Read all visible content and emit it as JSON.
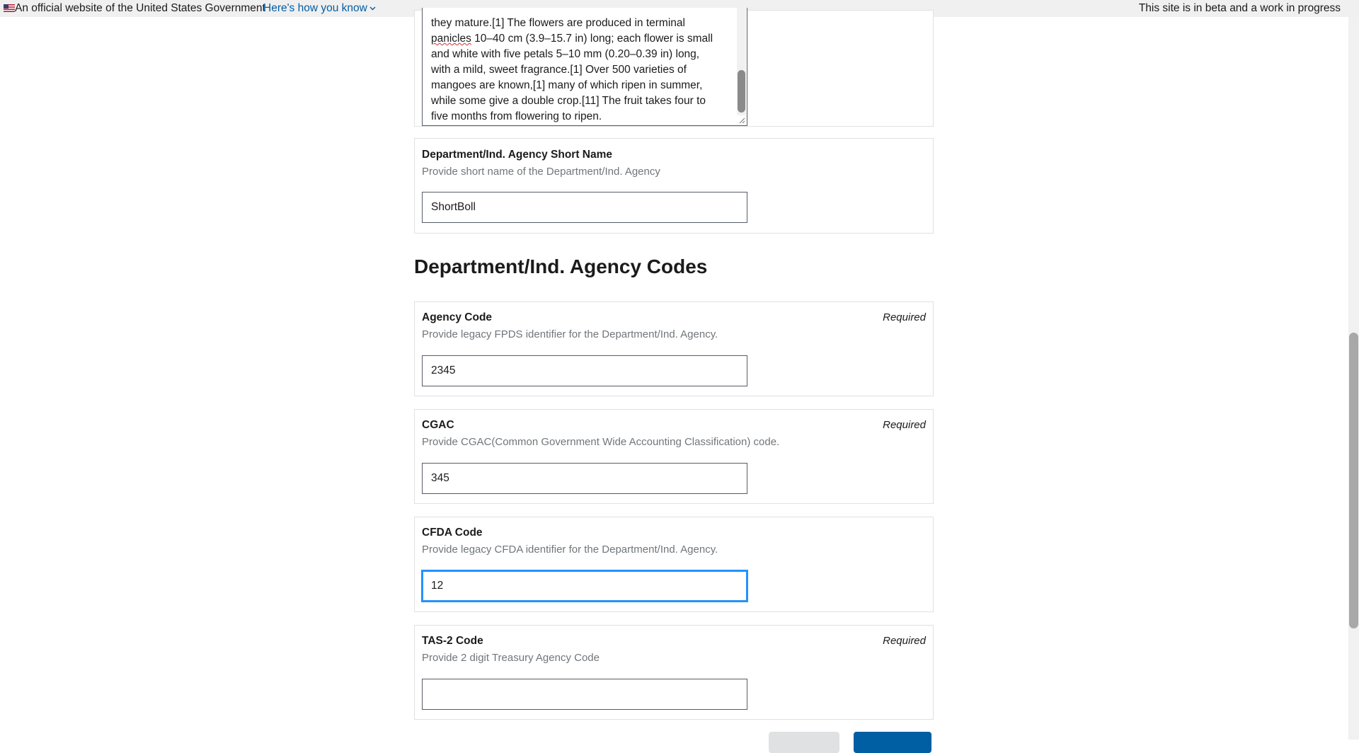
{
  "banner": {
    "official_text": "An official website of the United States Government",
    "how_you_know": "Here's how you know",
    "beta_text": "This site is in beta and a work in progress"
  },
  "description_field": {
    "text_lines": [
      "they mature.[1] The flowers are produced in terminal",
      "panicles 10–40 cm (3.9–15.7 in) long; each flower is small",
      "and white with five petals 5–10 mm (0.20–0.39 in) long,",
      "with a mild, sweet fragrance.[1] Over 500 varieties of",
      "mangoes are known,[1] many of which ripen in summer,",
      "while some give a double crop.[11] The fruit takes four to",
      "five months from flowering to ripen."
    ]
  },
  "short_name_field": {
    "label": "Department/Ind. Agency Short Name",
    "hint": "Provide short name of the Department/Ind. Agency",
    "value": "ShortBoll"
  },
  "codes_section": {
    "heading": "Department/Ind. Agency Codes"
  },
  "agency_code_field": {
    "label": "Agency Code",
    "hint": "Provide legacy FPDS identifier for the Department/Ind. Agency.",
    "required": "Required",
    "value": "2345"
  },
  "cgac_field": {
    "label": "CGAC",
    "hint": "Provide CGAC(Common Government Wide Accounting Classification) code.",
    "required": "Required",
    "value": "345"
  },
  "cfda_field": {
    "label": "CFDA Code",
    "hint": "Provide legacy CFDA identifier for the Department/Ind. Agency.",
    "value": "12"
  },
  "tas2_field": {
    "label": "TAS-2 Code",
    "hint": "Provide 2 digit Treasury Agency Code",
    "required": "Required",
    "value": ""
  },
  "colors": {
    "link": "#005ea2",
    "focus": "#2491ff",
    "hint": "#71767a",
    "border": "#dfe1e2"
  }
}
